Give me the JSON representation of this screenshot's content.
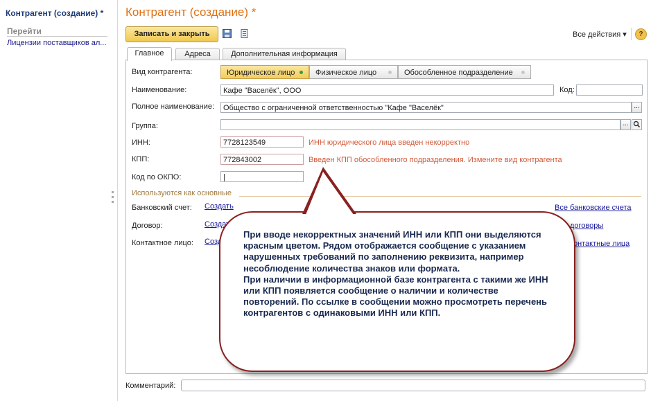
{
  "sidebar": {
    "title": "Контрагент (создание) *",
    "goto_label": "Перейти",
    "items": [
      {
        "label": "Лицензии поставщиков ал..."
      }
    ]
  },
  "form": {
    "title": "Контрагент (создание) *",
    "toolbar": {
      "save_close_label": "Записать и закрыть",
      "all_actions_label": "Все действия ▾",
      "help_label": "?"
    },
    "tabs": [
      {
        "label": "Главное",
        "active": true
      },
      {
        "label": "Адреса",
        "active": false
      },
      {
        "label": "Дополнительная информация",
        "active": false
      }
    ],
    "kind": {
      "label": "Вид контрагента:",
      "options": [
        {
          "label": "Юридическое лицо",
          "selected": true
        },
        {
          "label": "Физическое лицо",
          "selected": false
        },
        {
          "label": "Обособленное подразделение",
          "selected": false
        }
      ]
    },
    "name": {
      "label": "Наименование:",
      "value": "Кафе \"Васелёк\", ООО"
    },
    "code": {
      "label": "Код:",
      "value": ""
    },
    "full_name": {
      "label": "Полное наименование:",
      "value": "Общество с ограниченной ответственностью \"Кафе \"Васелёк\"",
      "button": "..."
    },
    "group": {
      "label": "Группа:",
      "value": "",
      "button": "...",
      "search_icon": "magnifier-icon"
    },
    "inn": {
      "label": "ИНН:",
      "value": "7728123549",
      "error": "ИНН юридического лица введен некорректно"
    },
    "kpp": {
      "label": "КПП:",
      "value": "772843002",
      "error": "Введен КПП обособленного подразделения. Измените вид контрагента"
    },
    "okpo": {
      "label": "Код по ОКПО:",
      "value": "|"
    },
    "defaults_group": {
      "title": "Используются как основные",
      "bank": {
        "label": "Банковский счет:",
        "link": "Создать",
        "all": "Все банковские счета"
      },
      "contract": {
        "label": "Договор:",
        "link": "Создать",
        "all": "Все договоры"
      },
      "contact": {
        "label": "Контактное лицо:",
        "link": "Создать",
        "all": "Все контактные лица"
      }
    },
    "comment": {
      "label": "Комментарий:",
      "value": ""
    }
  },
  "callout": {
    "text": "При вводе некорректных значений ИНН или КПП они выделяются красным цветом. Рядом отображается сообщение с указанием нарушенных требований по заполнению реквизита, например несоблюдение количества знаков или формата.\nПри наличии в информационной базе контрагента с такими же ИНН или КПП появляется сообщение о наличии и количестве повторений. По ссылке в сообщении можно просмотреть перечень контрагентов с одинаковыми ИНН или КПП."
  },
  "colors": {
    "title_orange": "#e07010",
    "error_red": "#d25b3a",
    "link_blue": "#1a1a9a",
    "button_yellow": "#f1c94e",
    "callout_border": "#8a2020"
  }
}
